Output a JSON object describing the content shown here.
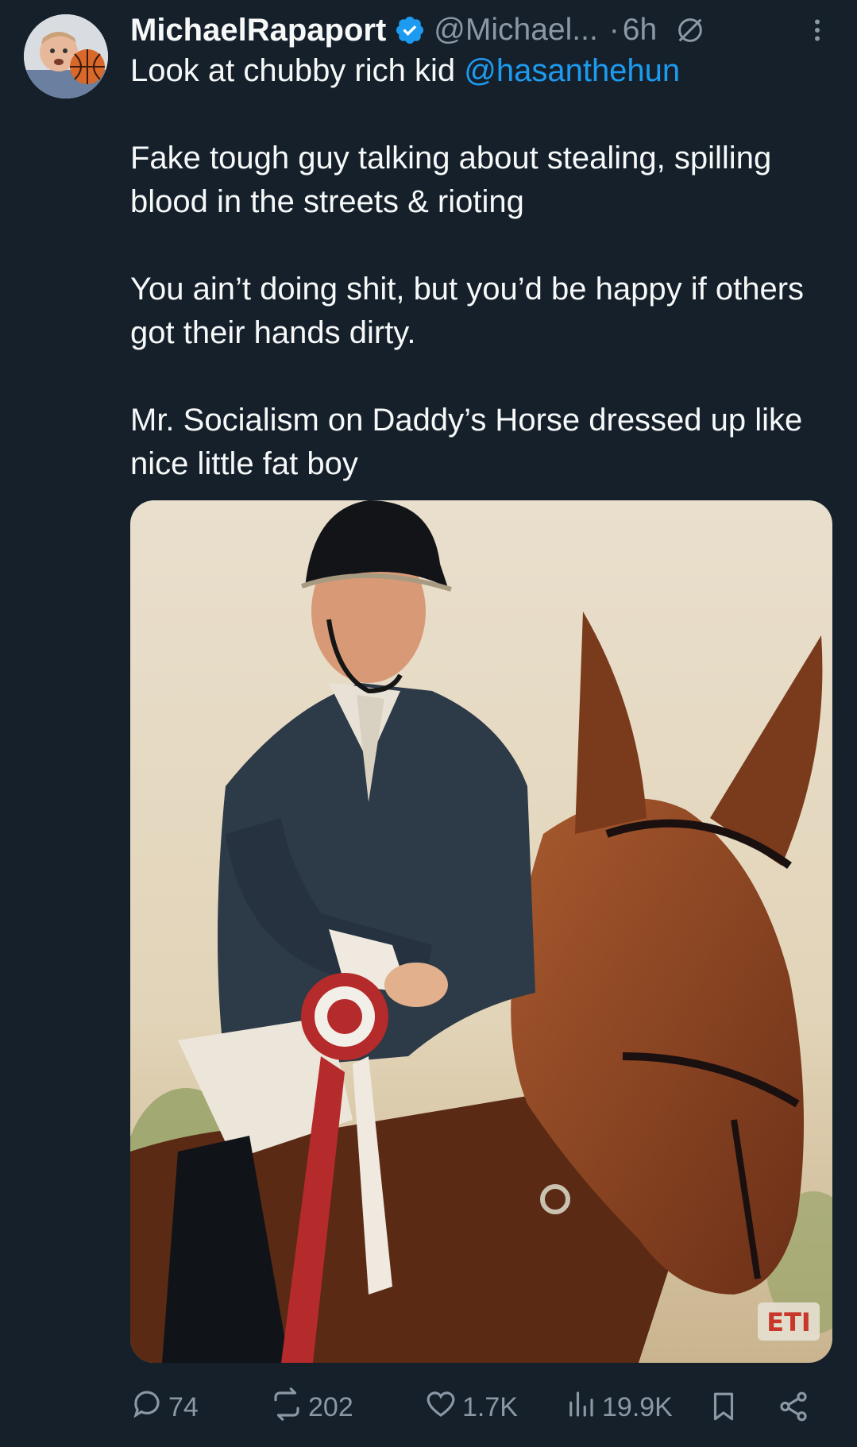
{
  "author": {
    "display_name": "MichaelRapaport",
    "handle": "@Michael...",
    "time": "6h",
    "separator": "·"
  },
  "tweet": {
    "line1_prefix": "Look at chubby rich kid ",
    "mention": "@hasanthehun",
    "para2": "Fake tough guy talking about stealing, spilling blood in the streets & rioting",
    "para3": "You ain’t doing shit, but you’d be happy if others got their hands dirty.",
    "para4": "Mr. Socialism on Daddy’s Horse dressed up like nice little fat boy"
  },
  "media": {
    "watermark_text": "ETI"
  },
  "actions": {
    "replies": "74",
    "reposts": "202",
    "likes": "1.7K",
    "views": "19.9K"
  },
  "colors": {
    "background": "#15202b",
    "text": "#f7f9f9",
    "muted": "#8b98a5",
    "accent": "#1d9bf0"
  },
  "icons": {
    "verified": "verified-badge-icon",
    "grok": "grok-icon",
    "more": "more-vertical-icon",
    "reply": "reply-icon",
    "repost": "repost-icon",
    "like": "heart-icon",
    "views": "views-chart-icon",
    "bookmark": "bookmark-icon",
    "share": "share-icon"
  }
}
